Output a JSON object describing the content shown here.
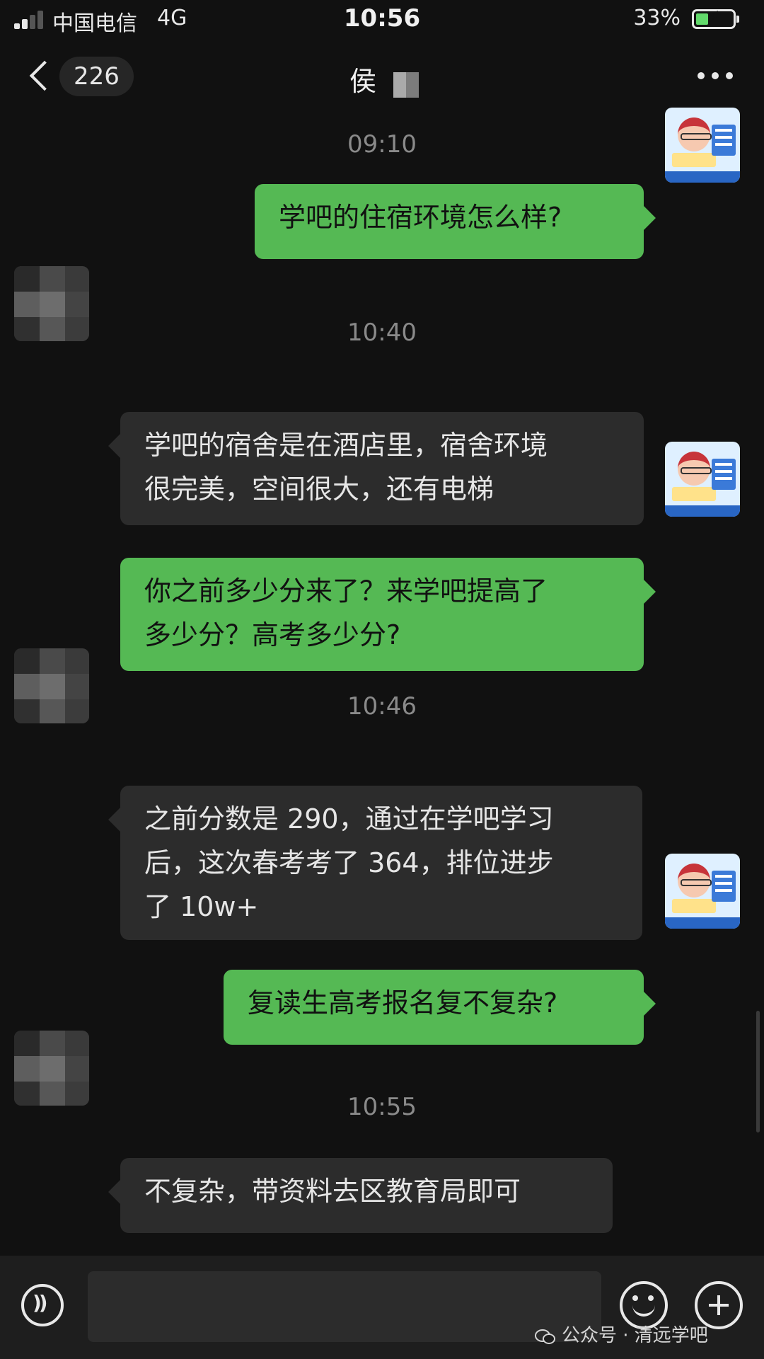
{
  "status_bar": {
    "carrier": "中国电信",
    "network": "4G",
    "time": "10:56",
    "battery_percent_label": "33%",
    "battery_level": 0.33
  },
  "header": {
    "unread_count": "226",
    "contact_name": "侯"
  },
  "messages": [
    {
      "type": "time",
      "text": "09:10"
    },
    {
      "type": "bubble",
      "side": "out",
      "lines": [
        "学吧的住宿环境怎么样?"
      ]
    },
    {
      "type": "time",
      "text": "10:40"
    },
    {
      "type": "bubble",
      "side": "in",
      "lines": [
        "学吧的宿舍是在酒店里，宿舍环境",
        "很完美，空间很大，还有电梯"
      ]
    },
    {
      "type": "bubble",
      "side": "out",
      "lines": [
        "你之前多少分来了？来学吧提高了",
        "多少分？高考多少分?"
      ]
    },
    {
      "type": "time",
      "text": "10:46"
    },
    {
      "type": "bubble",
      "side": "in",
      "lines": [
        "之前分数是 290，通过在学吧学习",
        "后，这次春考考了 364，排位进步",
        "了 10w+"
      ]
    },
    {
      "type": "bubble",
      "side": "out",
      "lines": [
        "复读生高考报名复不复杂?"
      ]
    },
    {
      "type": "time",
      "text": "10:55"
    },
    {
      "type": "bubble",
      "side": "in",
      "lines": [
        "不复杂，带资料去区教育局即可"
      ]
    }
  ],
  "input_bar": {
    "text_value": ""
  },
  "watermark": {
    "text": "公众号 · 清远学吧"
  },
  "colors": {
    "background": "#111111",
    "outgoing_bubble": "#55b954",
    "incoming_bubble": "#2c2c2c",
    "timestamp": "#8a8a8a"
  },
  "icons": [
    "back-chevron-icon",
    "more-dots-icon",
    "voice-icon",
    "emoji-icon",
    "plus-icon",
    "wechat-icon",
    "battery-charging-icon",
    "signal-icon"
  ]
}
